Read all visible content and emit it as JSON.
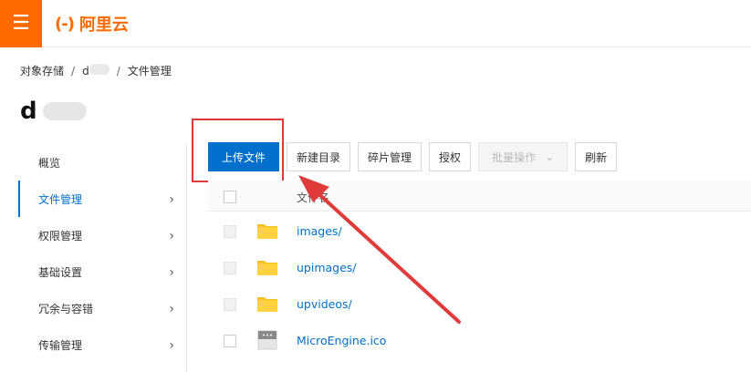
{
  "header": {
    "menu_icon": "☰",
    "logo_mark": "(-)",
    "logo_text": "阿里云",
    "brand_color": "#ff6a00"
  },
  "breadcrumb": {
    "root": "对象存储",
    "bucket": "d",
    "current": "文件管理",
    "separator": "/"
  },
  "bucket_title": "d",
  "sidebar": {
    "items": [
      {
        "label": "概览",
        "has_chevron": false,
        "active": false
      },
      {
        "label": "文件管理",
        "has_chevron": true,
        "active": true
      },
      {
        "label": "权限管理",
        "has_chevron": true,
        "active": false
      },
      {
        "label": "基础设置",
        "has_chevron": true,
        "active": false
      },
      {
        "label": "冗余与容错",
        "has_chevron": true,
        "active": false
      },
      {
        "label": "传输管理",
        "has_chevron": true,
        "active": false
      }
    ]
  },
  "toolbar": {
    "upload": "上传文件",
    "new_dir": "新建目录",
    "fragments": "碎片管理",
    "authorize": "授权",
    "batch": "批量操作",
    "refresh": "刷新"
  },
  "table": {
    "header": {
      "name": "文件名"
    },
    "rows": [
      {
        "name": "images/",
        "type": "folder"
      },
      {
        "name": "upimages/",
        "type": "folder"
      },
      {
        "name": "upvideos/",
        "type": "folder"
      },
      {
        "name": "MicroEngine.ico",
        "type": "file"
      }
    ]
  },
  "accent_color": "#0070cc",
  "annotation_color": "#e03b3b"
}
